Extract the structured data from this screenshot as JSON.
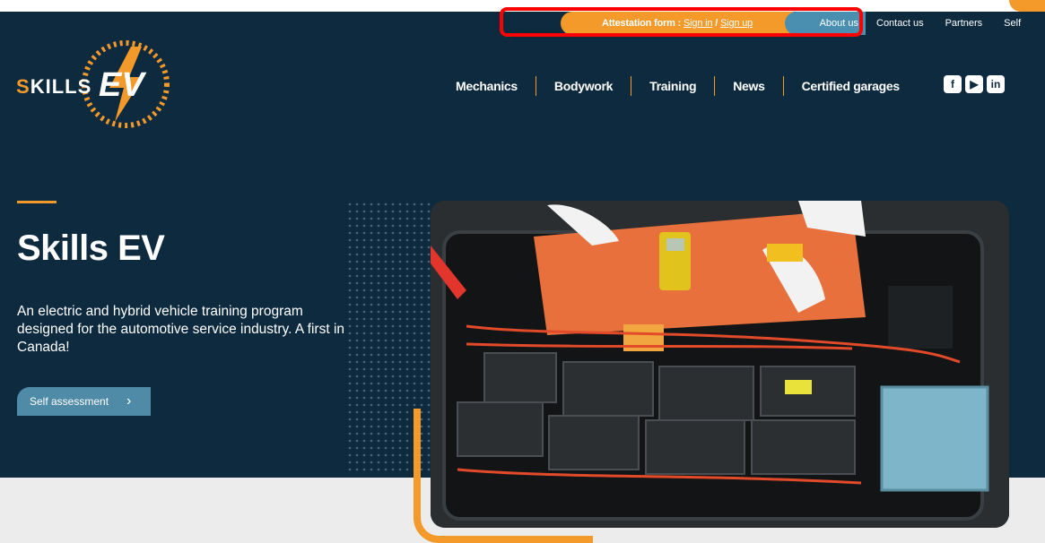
{
  "util_bar": {
    "attestation_label": "Attestation form :",
    "sign_in": "Sign in",
    "separator": "/",
    "sign_up": "Sign up",
    "about": "About us",
    "contact": "Contact us",
    "partners": "Partners",
    "self": "Self"
  },
  "logo": {
    "skills_first": "S",
    "skills_rest": "KILLS",
    "ev": "EV"
  },
  "nav": {
    "items": [
      "Mechanics",
      "Bodywork",
      "Training",
      "News",
      "Certified garages"
    ]
  },
  "social": {
    "facebook": "f",
    "youtube": "▶",
    "linkedin": "in"
  },
  "hero": {
    "title": "Skills EV",
    "description": "An electric and hybrid vehicle training program designed for the automotive service industry. A first in Canada!",
    "cta_label": "Self assessment",
    "cta_icon": "›"
  },
  "colors": {
    "navy": "#0e2a3f",
    "orange": "#f39a2b",
    "steel_blue": "#4f8aa6",
    "highlight_red": "#ff0000"
  }
}
